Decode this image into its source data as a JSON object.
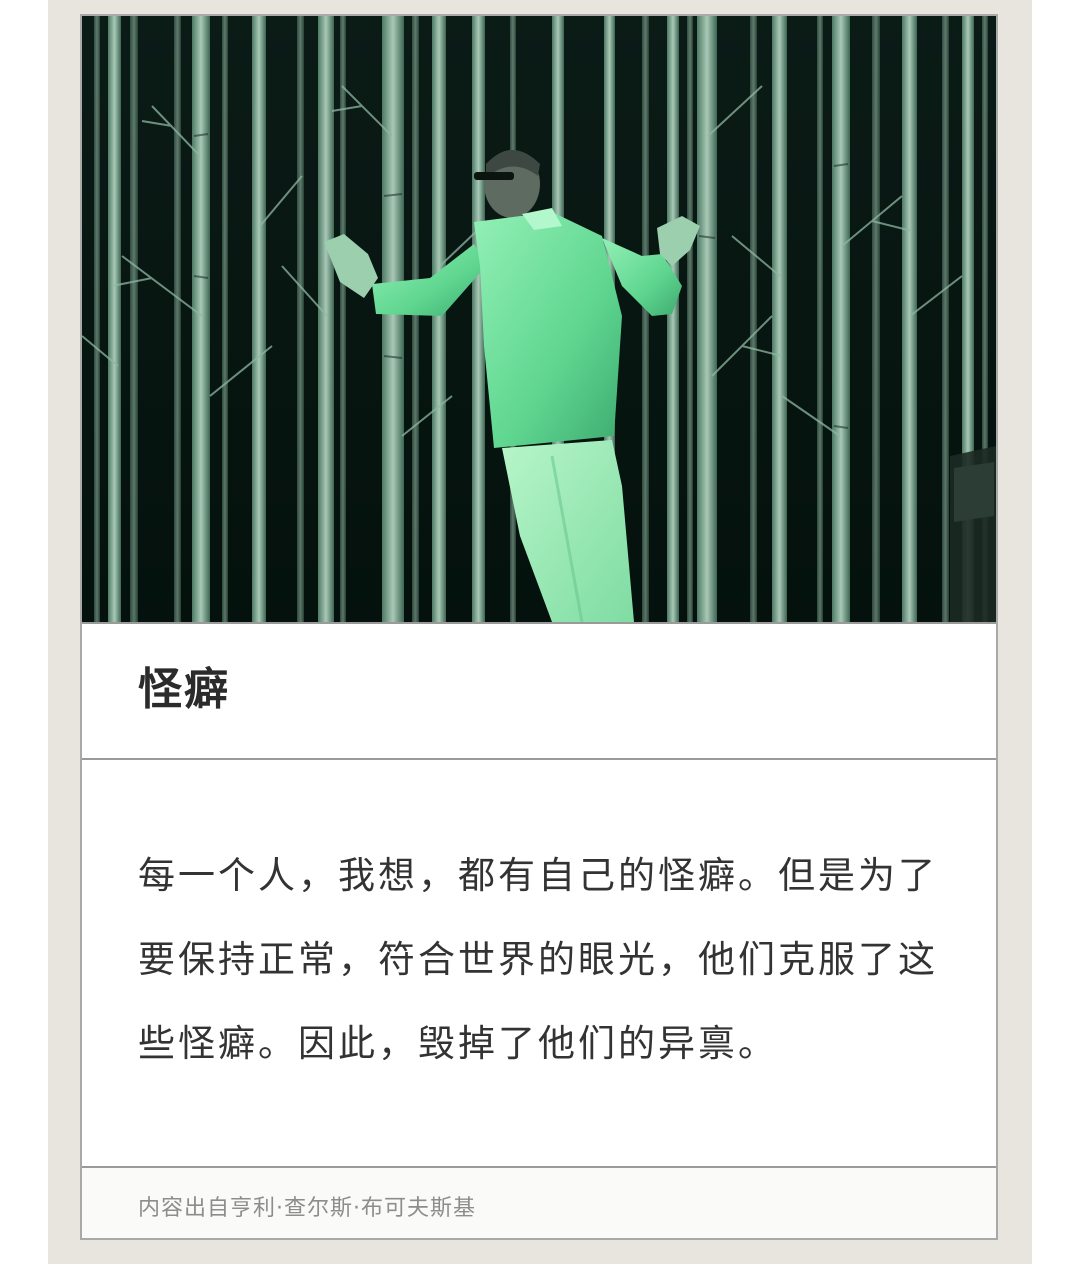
{
  "card": {
    "image_alt": "person in pajamas standing against painted birch-forest wall",
    "title": "怪癖",
    "quote": "每一个人，我想，都有自己的怪癖。但是为了要保持正常，符合世界的眼光，他们克服了这些怪癖。因此，毁掉了他们的异禀。",
    "source": "内容出自亨利·查尔斯·布可夫斯基"
  },
  "colors": {
    "frame_background": "#e8e5de",
    "card_background": "#ffffff",
    "border": "#9a9a9a",
    "title_text": "#2b2b2b",
    "body_text": "#333333",
    "source_text": "#8d8d8d"
  }
}
